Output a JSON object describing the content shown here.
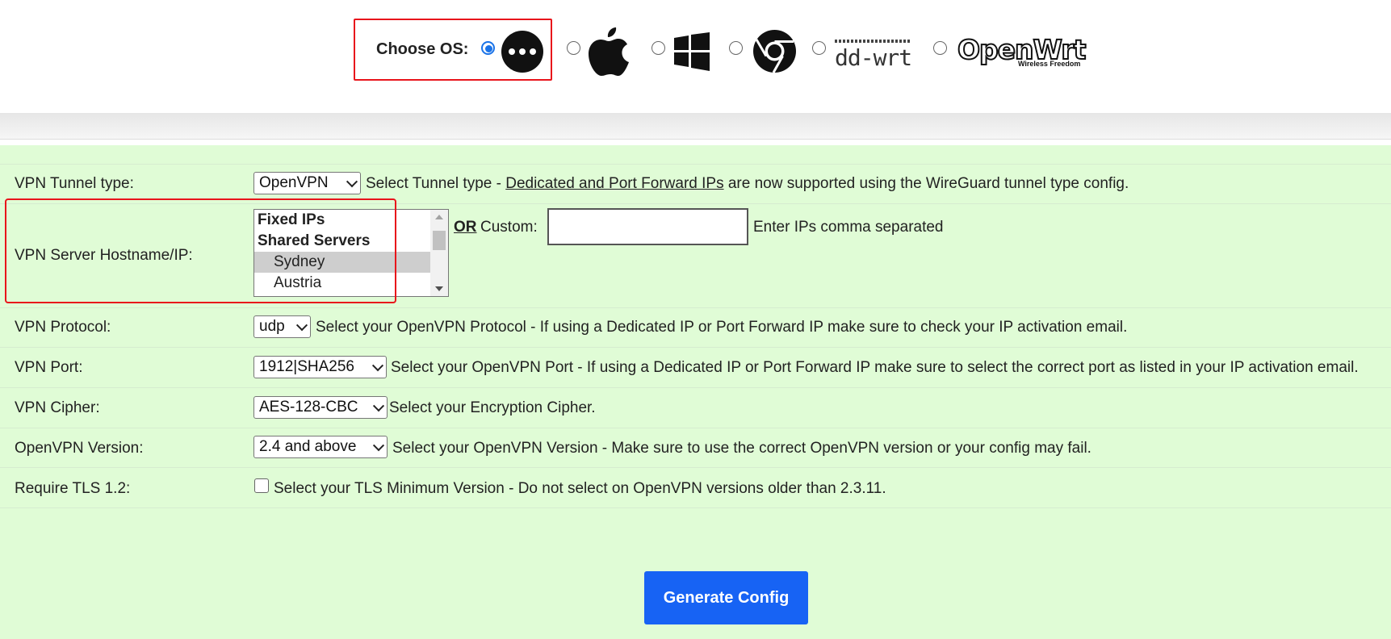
{
  "os_chooser": {
    "label": "Choose OS:",
    "options": [
      {
        "name": "other",
        "icon": "more-dots-icon",
        "checked": true
      },
      {
        "name": "macos",
        "icon": "apple-icon",
        "checked": false
      },
      {
        "name": "windows",
        "icon": "windows-icon",
        "checked": false
      },
      {
        "name": "chromeos",
        "icon": "chrome-icon",
        "checked": false
      },
      {
        "name": "ddwrt",
        "icon": "ddwrt-logo",
        "logo_text": "dd-wrt",
        "checked": false
      },
      {
        "name": "openwrt",
        "icon": "openwrt-logo",
        "logo_text": "OpenWrt",
        "logo_tagline": "Wireless Freedom",
        "checked": false
      }
    ]
  },
  "form": {
    "tunnel": {
      "label": "VPN Tunnel type:",
      "value": "OpenVPN",
      "desc_pre": "Select Tunnel type - ",
      "desc_link": "Dedicated and Port Forward IPs",
      "desc_post": " are now supported using the WireGuard tunnel type config."
    },
    "server": {
      "label": "VPN Server Hostname/IP:",
      "list": [
        {
          "text": "Fixed IPs",
          "kind": "group"
        },
        {
          "text": "Shared Servers",
          "kind": "group"
        },
        {
          "text": "Sydney",
          "kind": "option",
          "selected": true
        },
        {
          "text": "Austria",
          "kind": "option"
        }
      ],
      "or_text": "OR",
      "custom_label": "Custom:",
      "custom_value": "",
      "custom_hint": "Enter IPs comma separated"
    },
    "protocol": {
      "label": "VPN Protocol:",
      "value": "udp",
      "desc": "Select your OpenVPN Protocol - If using a Dedicated IP or Port Forward IP make sure to check your IP activation email."
    },
    "port": {
      "label": "VPN Port:",
      "value": "1912|SHA256",
      "desc": "Select your OpenVPN Port - If using a Dedicated IP or Port Forward IP make sure to select the correct port as listed in your IP activation email."
    },
    "cipher": {
      "label": "VPN Cipher:",
      "value": "AES-128-CBC",
      "desc": "Select your Encryption Cipher."
    },
    "version": {
      "label": "OpenVPN Version:",
      "value": "2.4 and above",
      "desc": "Select your OpenVPN Version - Make sure to use the correct OpenVPN version or your config may fail."
    },
    "tls": {
      "label": "Require TLS 1.2:",
      "checked": false,
      "desc": "Select your TLS Minimum Version - Do not select on OpenVPN versions older than 2.3.11."
    }
  },
  "generate_button": "Generate Config",
  "colors": {
    "highlight": "#e8141b",
    "form_bg": "#e0fcd6",
    "button_bg": "#1763f4",
    "radio_accent": "#1a73e8"
  }
}
